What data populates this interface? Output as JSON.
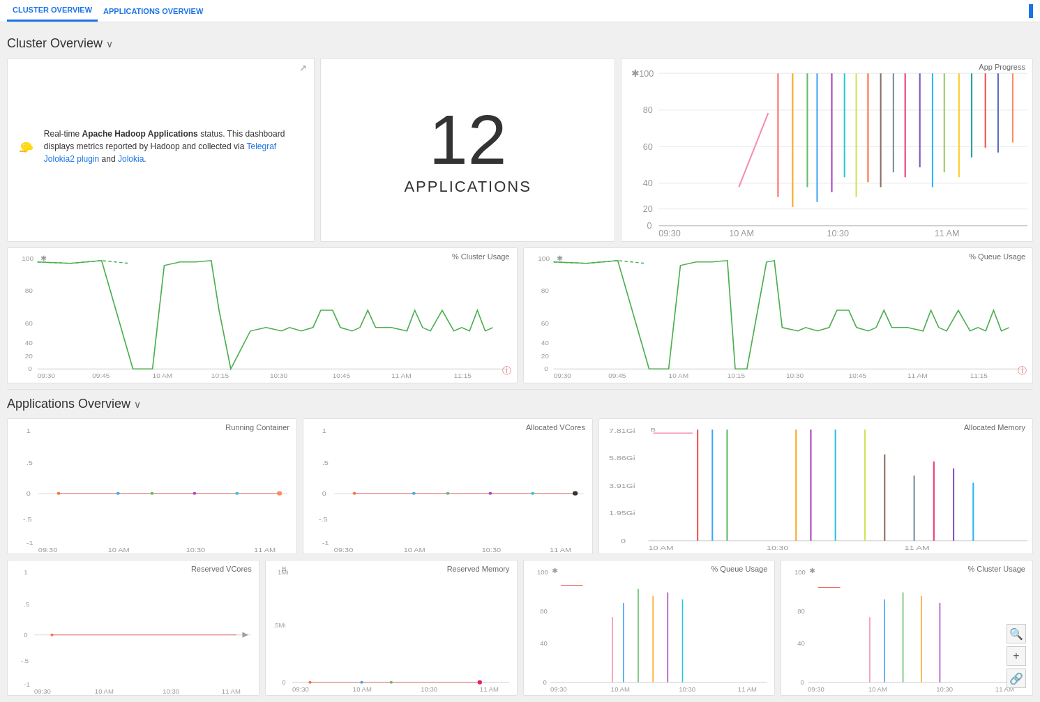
{
  "nav": {
    "tabs": [
      {
        "label": "CLUSTER OVERVIEW",
        "active": true
      },
      {
        "label": "APPLICATIONS OVERVIEW",
        "active": false
      }
    ]
  },
  "cluster_section": {
    "title": "Cluster Overview",
    "chevron": "∨"
  },
  "info_panel": {
    "description_pre": "Real-time ",
    "description_bold": "Apache Hadoop Applications",
    "description_mid": " status. This dashboard displays metrics reported by Hadoop and collected via ",
    "link1_text": "Telegraf Jolokia2 plugin",
    "description_and": " and ",
    "link2_text": "Jolokia",
    "description_end": ".",
    "export_icon": "⬡"
  },
  "big_number": {
    "value": "12",
    "label": "APPLICATIONS"
  },
  "charts": {
    "app_progress_title": "App Progress",
    "cluster_usage_title": "% Cluster Usage",
    "queue_usage_title": "% Queue Usage"
  },
  "apps_section": {
    "title": "Applications Overview",
    "chevron": "∨",
    "panels": [
      {
        "title": "Running Container"
      },
      {
        "title": "Allocated VCores"
      },
      {
        "title": "Allocated Memory"
      },
      {
        "title": "Reserved VCores"
      },
      {
        "title": "Reserved Memory"
      },
      {
        "title": "% Queue Usage"
      },
      {
        "title": "% Cluster Usage"
      }
    ]
  },
  "x_axis_labels_full": [
    "09:30",
    "09:45",
    "10 AM",
    "10:15",
    "10:30",
    "10:45",
    "11 AM",
    "11:15"
  ],
  "x_axis_labels_short": [
    "09:30",
    "10 AM",
    "10:30",
    "11 AM"
  ],
  "y_axis_100": [
    "100",
    "80",
    "60",
    "40",
    "20",
    "0"
  ],
  "y_axis_1": [
    "1",
    ".5",
    "0",
    "-.5",
    "-1"
  ],
  "bottom_buttons": [
    {
      "icon": "🔍",
      "name": "search"
    },
    {
      "icon": "+",
      "name": "zoom-in"
    },
    {
      "icon": "⬡",
      "name": "share"
    }
  ]
}
